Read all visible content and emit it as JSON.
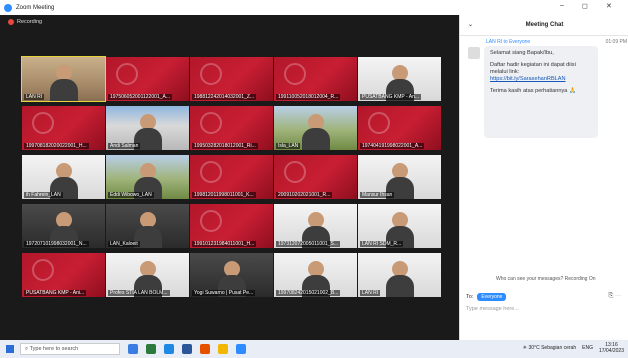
{
  "window": {
    "title": "Zoom Meeting",
    "controls": [
      "–",
      "◻",
      "✕"
    ]
  },
  "gallery": {
    "recording_label": "Recording",
    "tiles": [
      {
        "label": "LAN RI",
        "style": "photo",
        "active": true
      },
      {
        "label": "197506052001122001_A...",
        "style": "red"
      },
      {
        "label": "198812242014032001_Z...",
        "style": "red"
      },
      {
        "label": "199110052018012004_R...",
        "style": "red"
      },
      {
        "label": "PUSATBANG KMP - An...",
        "style": "white"
      },
      {
        "label": "199708182020022001_H...",
        "style": "red"
      },
      {
        "label": "Andi Salman",
        "style": "building"
      },
      {
        "label": "199503282018012001_Ri...",
        "style": "red"
      },
      {
        "label": "Isla_LAN",
        "style": "field"
      },
      {
        "label": "197404191998022001_A...",
        "style": "red"
      },
      {
        "label": "ih Fahrein_LAN",
        "style": "white"
      },
      {
        "label": "Eddi Wibowo_LAN",
        "style": "field"
      },
      {
        "label": "199812011998011001_K...",
        "style": "red"
      },
      {
        "label": "200910202021001_R...",
        "style": "red"
      },
      {
        "label": "Mansur Ihsan",
        "style": "white"
      },
      {
        "label": "197207101998032001_N...",
        "style": "dark"
      },
      {
        "label": "LAN_Kaloeit",
        "style": "dark"
      },
      {
        "label": "199101231984011001_H...",
        "style": "red"
      },
      {
        "label": "197312072005011001_S...",
        "style": "white"
      },
      {
        "label": "LAN RI SDM_R...",
        "style": "white"
      },
      {
        "label": "PUSATBANG KMP - Ani...",
        "style": "red"
      },
      {
        "label": "Profes STIA LAN BOLM...",
        "style": "white"
      },
      {
        "label": "Yogi Suwarno | Pusat Pe...",
        "style": "dark"
      },
      {
        "label": "199708242015021002_B...",
        "style": "white"
      },
      {
        "label": "LAN RI",
        "style": "white"
      }
    ]
  },
  "chat": {
    "title": "Meeting Chat",
    "collapse_icon": "chevron-down-icon",
    "message": {
      "from": "LAN RI to Everyone",
      "time": "01:09 PM",
      "greeting": "Selamat siang Bapak/Ibu,",
      "body": "Daftar hadir kegiatan ini dapat diisi melalui link:",
      "link": "https://bit.ly/SarasehanRBLAN",
      "closing": "Terima kasih atas perhatiannya 🙏"
    },
    "who_can_see": "Who can see your messages? Recording On",
    "to_label": "To:",
    "to_value": "Everyone",
    "input_placeholder": "Type message here..."
  },
  "taskbar": {
    "search_placeholder": "Type here to search",
    "weather": "30°C Sebagian cerah",
    "language": "ENG",
    "time": "13:16",
    "date": "17/04/2023"
  },
  "colors": {
    "accent": "#2d8cff",
    "recording": "#e8473d",
    "tile_red": "#c81e33"
  }
}
